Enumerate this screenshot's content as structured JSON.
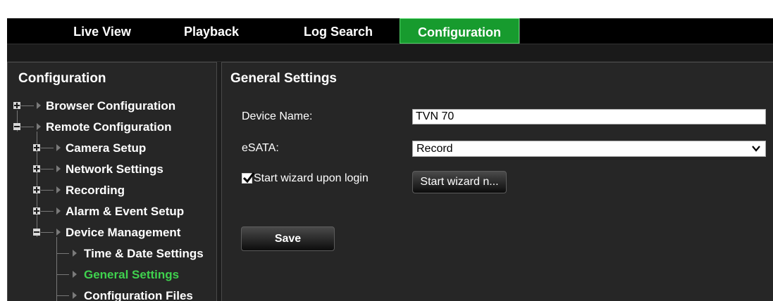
{
  "tabs": [
    {
      "label": "Live View"
    },
    {
      "label": "Playback"
    },
    {
      "label": "Log Search"
    },
    {
      "label": "Configuration",
      "active": true
    }
  ],
  "sidebar": {
    "title": "Configuration",
    "items": [
      {
        "label": "Browser Configuration",
        "state": "collapsed"
      },
      {
        "label": "Remote Configuration",
        "state": "expanded"
      },
      {
        "label": "Camera Setup",
        "state": "collapsed"
      },
      {
        "label": "Network Settings",
        "state": "collapsed"
      },
      {
        "label": "Recording",
        "state": "collapsed"
      },
      {
        "label": "Alarm & Event Setup",
        "state": "collapsed"
      },
      {
        "label": "Device Management",
        "state": "expanded"
      },
      {
        "label": "Time & Date Settings"
      },
      {
        "label": "General Settings",
        "selected": true
      },
      {
        "label": "Configuration Files"
      }
    ]
  },
  "main": {
    "title": "General Settings",
    "device_name_label": "Device Name:",
    "device_name_value": "TVN 70",
    "esata_label": "eSATA:",
    "esata_value": "Record",
    "wizard_checkbox_label": "Start wizard upon login",
    "wizard_checked": true,
    "wizard_button": "Start wizard n...",
    "save_button": "Save"
  },
  "colors": {
    "active_tab": "#179b2e",
    "selected_item": "#3fd24e",
    "panel_bg": "#262626"
  }
}
